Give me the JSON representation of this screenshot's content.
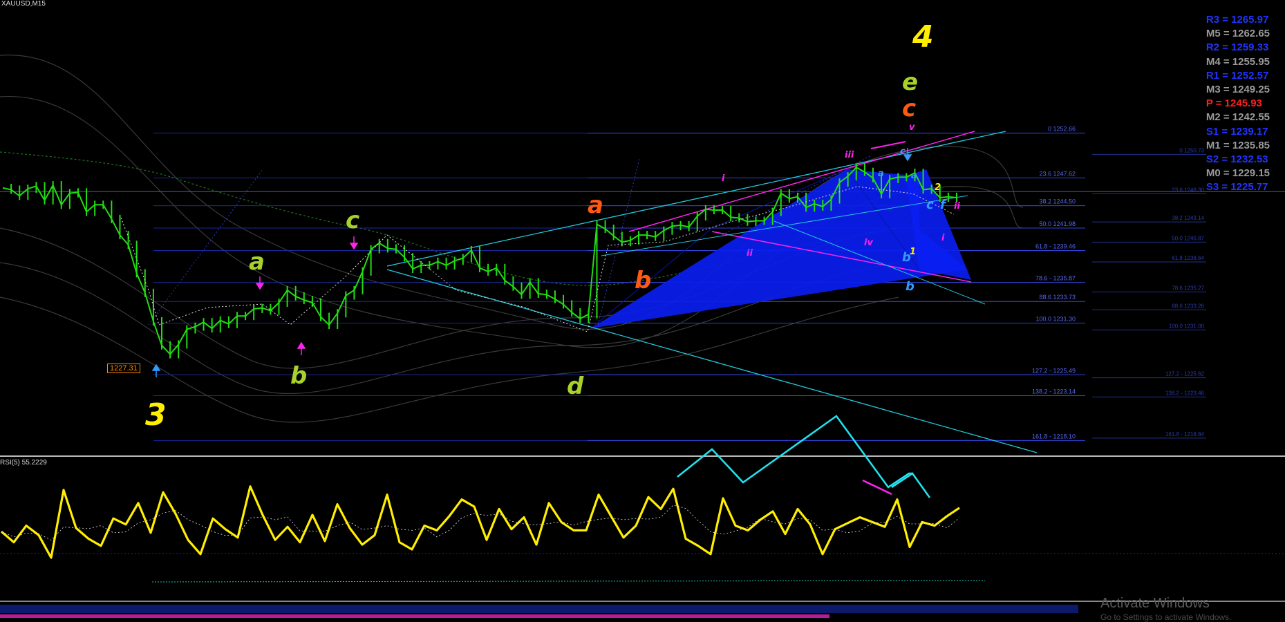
{
  "window": {
    "symbol": "XAUUSD,M15"
  },
  "pivots": [
    {
      "label": "R3 = 1265.97",
      "color": "#2233ff"
    },
    {
      "label": "M5 = 1262.65",
      "color": "#9a9a9a"
    },
    {
      "label": "R2 = 1259.33",
      "color": "#2233ff"
    },
    {
      "label": "M4 = 1255.95",
      "color": "#9a9a9a"
    },
    {
      "label": "R1 = 1252.57",
      "color": "#2233ff"
    },
    {
      "label": "M3 = 1249.25",
      "color": "#9a9a9a"
    },
    {
      "label": "P  = 1245.93",
      "color": "#ff2020"
    },
    {
      "label": "M2 = 1242.55",
      "color": "#9a9a9a"
    },
    {
      "label": "S1 = 1239.17",
      "color": "#2233ff"
    },
    {
      "label": "M1 = 1235.85",
      "color": "#9a9a9a"
    },
    {
      "label": "S2 = 1232.53",
      "color": "#2233ff"
    },
    {
      "label": "M0 = 1229.15",
      "color": "#9a9a9a"
    },
    {
      "label": "S3 = 1225.77",
      "color": "#2233ff"
    }
  ],
  "price_tag": "1227.31",
  "rsi_label": "RSI(5) 55.2229",
  "watermark": {
    "line1": "Activate Windows",
    "line2": "Go to Settings to activate Windows."
  },
  "colors": {
    "price": "#22dd11",
    "rsi": "#ffee00",
    "trend": "#22c8dd",
    "magenta": "#ff22ee",
    "harmonic": "#0a1ef0",
    "fib": "#3344dd"
  },
  "chart_data": {
    "type": "line",
    "series": [
      {
        "name": "XAUUSD,M15",
        "values": [
          1246.5,
          1246.3,
          1245.6,
          1246.4,
          1246.7,
          1245.1,
          1246.8,
          1244.6,
          1245.9,
          1246.0,
          1243.8,
          1244.6,
          1244.6,
          1243.0,
          1241.2,
          1240.1,
          1236.9,
          1234.7,
          1231.5,
          1228.8,
          1227.8,
          1228.9,
          1230.6,
          1230.9,
          1231.4,
          1230.7,
          1231.6,
          1231.2,
          1232.1,
          1232.1,
          1232.9,
          1233.0,
          1232.7,
          1233.6,
          1235.0,
          1234.3,
          1233.9,
          1233.6,
          1232.0,
          1231.1,
          1232.4,
          1234.4,
          1235.0,
          1237.1,
          1239.6,
          1240.3,
          1239.7,
          1239.6,
          1238.7,
          1237.4,
          1237.8,
          1237.8,
          1238.2,
          1237.8,
          1238.3,
          1238.6,
          1239.5,
          1237.5,
          1237.1,
          1237.5,
          1236.1,
          1235.4,
          1234.5,
          1235.9,
          1234.6,
          1234.5,
          1234.0,
          1233.4,
          1232.5,
          1231.8,
          1232.3,
          1242.4,
          1241.9,
          1241.1,
          1240.4,
          1240.6,
          1241.2,
          1241.2,
          1241.0,
          1241.7,
          1242.2,
          1242.3,
          1242.1,
          1243.3,
          1244.1,
          1244.0,
          1244.0,
          1243.2,
          1243.1,
          1242.7,
          1242.8,
          1242.8,
          1243.8,
          1245.9,
          1245.3,
          1245.5,
          1244.3,
          1244.7,
          1244.4,
          1245.2,
          1247.1,
          1247.8,
          1248.8,
          1248.3,
          1247.6,
          1245.8,
          1247.5,
          1247.7,
          1247.7,
          1248.2,
          1246.3,
          1246.4,
          1245.4,
          1245.5,
          1245.4
        ],
        "x_start": "11 Dec 2017 08:00",
        "x_step": "15 min"
      },
      {
        "name": "RSI(5)",
        "values": [
          47,
          38,
          52,
          44,
          25,
          82,
          50,
          41,
          35,
          58,
          53,
          71,
          46,
          80,
          62,
          40,
          28,
          58,
          49,
          42,
          85,
          61,
          40,
          51,
          38,
          61,
          39,
          70,
          50,
          36,
          44,
          78,
          38,
          32,
          52,
          48,
          60,
          74,
          68,
          40,
          66,
          49,
          59,
          36,
          71,
          55,
          48,
          48,
          78,
          60,
          42,
          52,
          76,
          66,
          83,
          41,
          35,
          28,
          75,
          52,
          48,
          57,
          64,
          45,
          66,
          53,
          28,
          49,
          54,
          59,
          55,
          51,
          74,
          34,
          55,
          52,
          60,
          67
        ],
        "x_start": "11 Dec 2017 08:00",
        "x_step": "15 min"
      }
    ],
    "ylim": [
      1216.5,
      1267.0
    ],
    "rsi_ylim": [
      0,
      100
    ],
    "fib_levels_left": [
      {
        "label": "0 1252.66",
        "value": 1252.66
      },
      {
        "label": "23.6 1247.62",
        "value": 1247.62
      },
      {
        "label": "38.2 1244.50",
        "value": 1244.5
      },
      {
        "label": "50.0 1241.98",
        "value": 1241.98
      },
      {
        "label": "61.8 - 1239.46",
        "value": 1239.46
      },
      {
        "label": "78.6 - 1235.87",
        "value": 1235.87
      },
      {
        "label": "88.6 1233.73",
        "value": 1233.73
      },
      {
        "label": "100.0 1231.30",
        "value": 1231.3
      },
      {
        "label": "127.2 - 1225.49",
        "value": 1225.49
      },
      {
        "label": "138.2 - 1223.14",
        "value": 1223.14
      },
      {
        "label": "161.8 - 1218.10",
        "value": 1218.1
      }
    ],
    "fib_levels_right": [
      {
        "label": "0 1250.73",
        "value": 1250.73
      },
      {
        "label": "23.6 1246.30",
        "value": 1246.3
      },
      {
        "label": "38.2 1243.14",
        "value": 1243.14
      },
      {
        "label": "50.0 1240.87",
        "value": 1240.87
      },
      {
        "label": "61.8 1238.64",
        "value": 1238.64
      },
      {
        "label": "78.6 1235.27",
        "value": 1235.27
      },
      {
        "label": "88.6 1233.26",
        "value": 1233.26
      },
      {
        "label": "100.0 1231.00",
        "value": 1231.0
      },
      {
        "label": "127.2 - 1225.62",
        "value": 1225.62
      },
      {
        "label": "138.2 - 1223.46",
        "value": 1223.46
      },
      {
        "label": "161.8 - 1218.84",
        "value": 1218.84
      }
    ],
    "annotations": [
      {
        "text": "3",
        "color": "#ffee00",
        "size": "xl"
      },
      {
        "text": "a",
        "color": "#a8d22a",
        "size": "l"
      },
      {
        "text": "b",
        "color": "#a8d22a",
        "size": "l"
      },
      {
        "text": "c",
        "color": "#a8d22a",
        "size": "l"
      },
      {
        "text": "d",
        "color": "#a8d22a",
        "size": "l"
      },
      {
        "text": "a",
        "color": "#ff5a10",
        "size": "l"
      },
      {
        "text": "b",
        "color": "#ff5a10",
        "size": "l"
      },
      {
        "text": "4",
        "color": "#ffee00",
        "size": "xl"
      },
      {
        "text": "e",
        "color": "#a8d22a",
        "size": "l"
      },
      {
        "text": "c",
        "color": "#ff5a10",
        "size": "l"
      },
      {
        "text": "v",
        "color": "#ff22ee",
        "size": "s"
      },
      {
        "text": "iii",
        "color": "#ff22ee",
        "size": "s"
      },
      {
        "text": "i",
        "color": "#ff22ee",
        "size": "s"
      },
      {
        "text": "ii",
        "color": "#ff22ee",
        "size": "s"
      },
      {
        "text": "iv",
        "color": "#ff22ee",
        "size": "s"
      },
      {
        "text": "a",
        "color": "#3399ff",
        "size": "s"
      },
      {
        "text": "a",
        "color": "#3399ff",
        "size": "s"
      },
      {
        "text": "b",
        "color": "#3399ff",
        "size": "m"
      },
      {
        "text": "b",
        "color": "#3399ff",
        "size": "m"
      },
      {
        "text": "c",
        "color": "#3399ff",
        "size": "m"
      },
      {
        "text": "c",
        "color": "#3399ff",
        "size": "s"
      },
      {
        "text": "f",
        "color": "#3399ff",
        "size": "m"
      },
      {
        "text": "1",
        "color": "#ffee00",
        "size": "s"
      },
      {
        "text": "2",
        "color": "#ffee00",
        "size": "s"
      },
      {
        "text": "i",
        "color": "#ff22ee",
        "size": "s"
      },
      {
        "text": "ii",
        "color": "#ff22ee",
        "size": "s"
      }
    ]
  }
}
